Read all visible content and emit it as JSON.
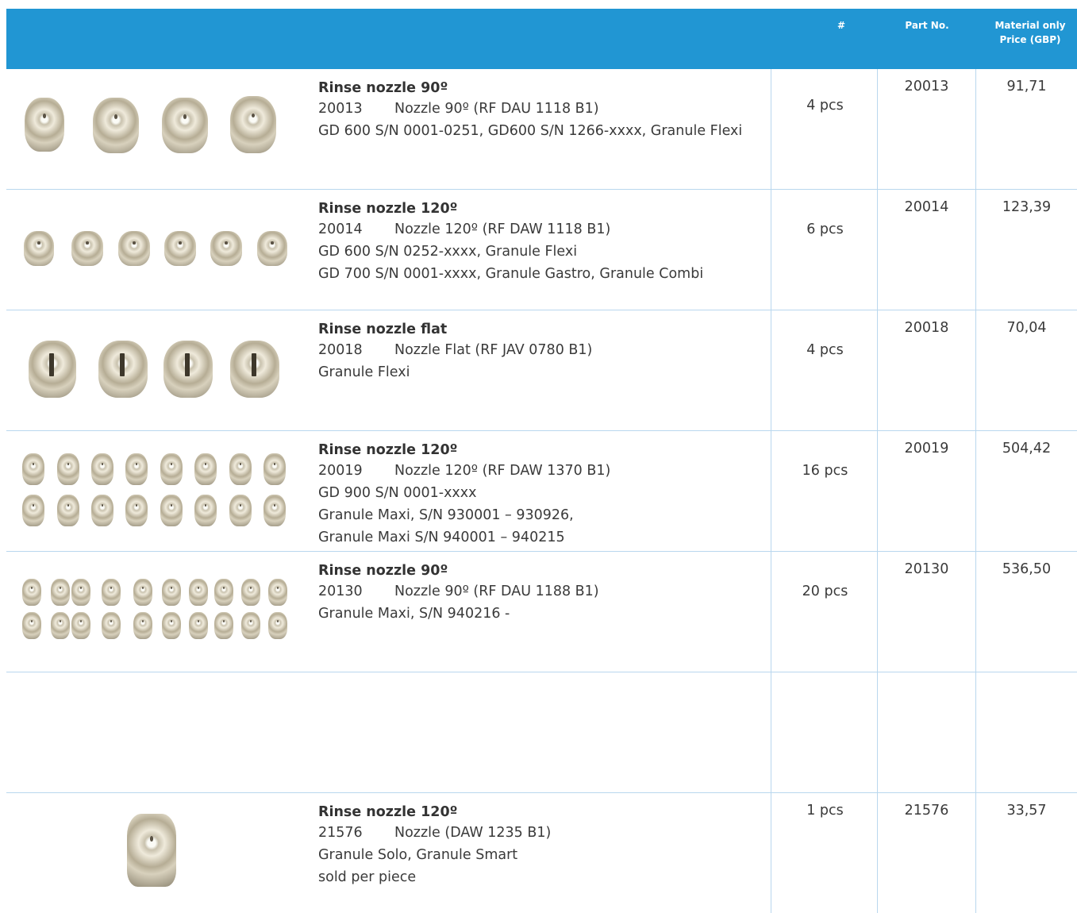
{
  "header": {
    "qty_label": "#",
    "part_label": "Part No.",
    "price_label_1": "Material only",
    "price_label_2": "Price (GBP)"
  },
  "rows": [
    {
      "title": "Rinse nozzle 90º",
      "part_no": "20013",
      "nozzle": "Nozzle 90º (RF DAU 1118 B1)",
      "lines": [
        "GD 600 S/N 0001-0251, GD600 S/N 1266-xxxx, Granule Flexi"
      ],
      "qty": "4 pcs",
      "part": "20013",
      "price": "91,71"
    },
    {
      "title": "Rinse nozzle 120º",
      "part_no": "20014",
      "nozzle": "Nozzle 120º (RF DAW 1118 B1)",
      "lines": [
        "GD 600 S/N 0252-xxxx, Granule Flexi",
        "GD 700 S/N 0001-xxxx, Granule Gastro, Granule Combi"
      ],
      "qty": "6 pcs",
      "part": "20014",
      "price": "123,39"
    },
    {
      "title": "Rinse nozzle flat",
      "part_no": "20018",
      "nozzle": "Nozzle Flat (RF JAV 0780 B1)",
      "lines": [
        "Granule Flexi"
      ],
      "qty": "4 pcs",
      "part": "20018",
      "price": "70,04"
    },
    {
      "title": "Rinse nozzle 120º",
      "part_no": "20019",
      "nozzle": "Nozzle 120º (RF DAW 1370 B1)",
      "lines": [
        "GD 900 S/N 0001-xxxx",
        "Granule Maxi, S/N 930001 – 930926,",
        "Granule Maxi S/N 940001 – 940215"
      ],
      "qty": "16 pcs",
      "part": "20019",
      "price": "504,42"
    },
    {
      "title": "Rinse nozzle 90º",
      "part_no": "20130",
      "nozzle": "Nozzle 90º (RF DAU 1188 B1)",
      "lines": [
        "Granule Maxi, S/N 940216 -"
      ],
      "qty": "20 pcs",
      "part": "20130",
      "price": "536,50"
    },
    {
      "title": "Rinse nozzle 120º",
      "part_no": "21576",
      "nozzle": "Nozzle (DAW 1235 B1)",
      "lines": [
        "Granule Solo, Granule Smart",
        "sold per piece"
      ],
      "qty": "1 pcs",
      "part": "21576",
      "price": "33,57"
    }
  ],
  "icons": {
    "nozzle": "nozzle-photo-icon"
  },
  "colors": {
    "header": "#2196d3",
    "grid": "#b9d7ee",
    "text": "#3a3a3a"
  }
}
